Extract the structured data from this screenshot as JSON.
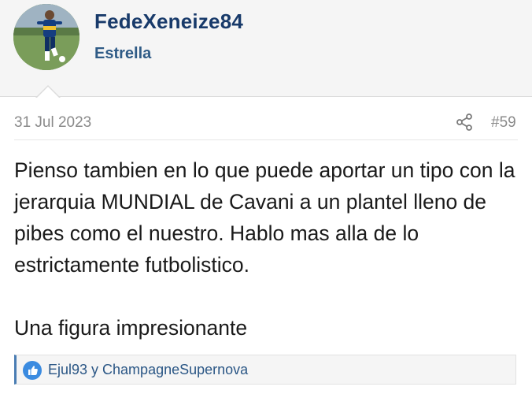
{
  "user": {
    "username": "FedeXeneize84",
    "title": "Estrella"
  },
  "post": {
    "date": "31 Jul 2023",
    "number": "#59",
    "paragraphs": [
      "Pienso tambien en lo que puede aportar un tipo con la jerarquia MUNDIAL de Cavani a un plantel lleno de pibes como el nuestro. Hablo mas alla de lo estrictamente futbolistico.",
      "Una figura impresionante"
    ]
  },
  "reactions": {
    "users_text": "Ejul93 y ChampagneSupernova",
    "icon": "like-icon"
  },
  "colors": {
    "username": "#183a6a",
    "user_title": "#2f5b86",
    "accent": "#4a7db3",
    "meta": "#8a8a8a"
  }
}
